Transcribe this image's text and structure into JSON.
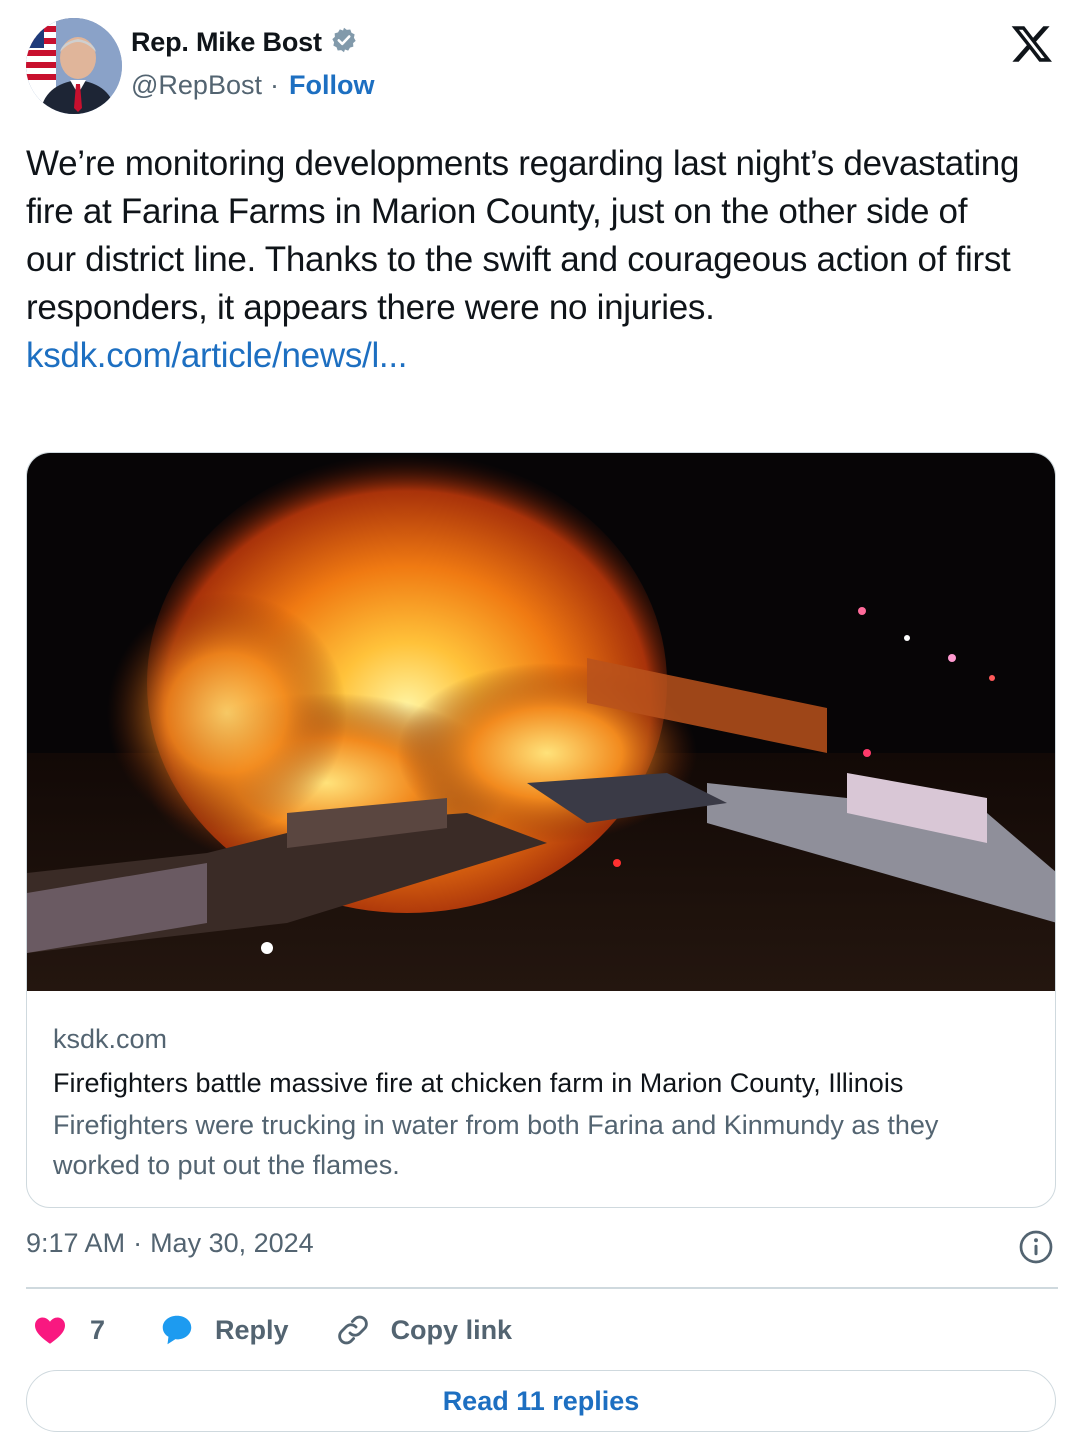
{
  "author": {
    "name": "Rep. Mike Bost",
    "handle": "@RepBost",
    "separator": "·",
    "follow_label": "Follow",
    "verified_badge_icon": "verified-badge-icon",
    "avatar_icon": "profile-avatar"
  },
  "brand": {
    "logo_icon": "x-logo-icon"
  },
  "tweet": {
    "text": "We’re monitoring developments regarding last night’s devastating fire at Farina Farms in Marion County, just on the other side of our district line. Thanks to the swift and courageous action of first responders, it appears there were no injuries.",
    "link_text": "ksdk.com/article/news/l..."
  },
  "card": {
    "image_icon": "fire-photo",
    "domain": "ksdk.com",
    "title": "Firefighters battle massive fire at chicken farm in Marion County, Illinois",
    "description": "Firefighters were trucking in water from both Farina and Kinmundy as they worked to put out the flames."
  },
  "meta": {
    "time": "9:17 AM",
    "separator": "·",
    "date": "May 30, 2024",
    "info_icon": "info-icon"
  },
  "actions": {
    "like_count": "7",
    "reply_label": "Reply",
    "copy_link_label": "Copy link",
    "read_replies_label": "Read 11 replies"
  },
  "colors": {
    "link_blue": "#1d6fc1",
    "like_pink": "#f91880",
    "reply_blue": "#1d9bf0",
    "secondary_text": "#536471",
    "border": "#cfd9de"
  }
}
